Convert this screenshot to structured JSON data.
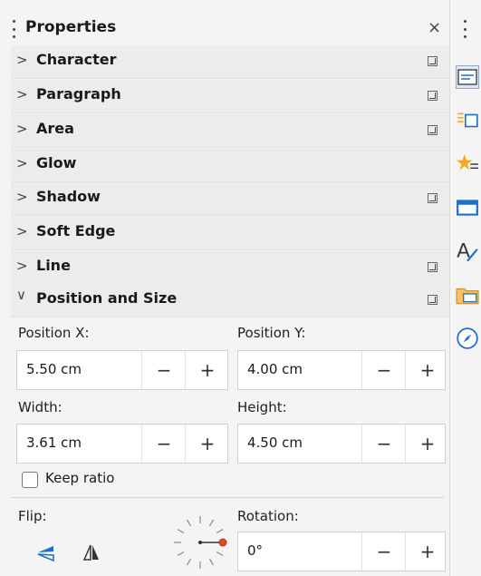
{
  "panel": {
    "title": "Properties",
    "close_icon": "close-icon"
  },
  "sections": [
    {
      "label": "Character",
      "expanded": false,
      "has_more": true
    },
    {
      "label": "Paragraph",
      "expanded": false,
      "has_more": true
    },
    {
      "label": "Area",
      "expanded": false,
      "has_more": true
    },
    {
      "label": "Glow",
      "expanded": false,
      "has_more": false
    },
    {
      "label": "Shadow",
      "expanded": false,
      "has_more": true
    },
    {
      "label": "Soft Edge",
      "expanded": false,
      "has_more": false
    },
    {
      "label": "Line",
      "expanded": false,
      "has_more": true
    },
    {
      "label": "Position and Size",
      "expanded": true,
      "has_more": true
    }
  ],
  "position_size": {
    "pos_x_label": "Position X:",
    "pos_x_value": "5.50 cm",
    "pos_y_label": "Position Y:",
    "pos_y_value": "4.00 cm",
    "width_label": "Width:",
    "width_value": "3.61 cm",
    "height_label": "Height:",
    "height_value": "4.50 cm",
    "keep_ratio_label": "Keep ratio",
    "keep_ratio_checked": false,
    "flip_label": "Flip:",
    "rotation_label": "Rotation:",
    "rotation_value": "0°",
    "minus": "−",
    "plus": "+"
  },
  "sidebar_icons": [
    "properties-icon",
    "styles-icon",
    "gallery-icon",
    "master-slides-icon",
    "font-icon",
    "navigator-icon",
    "compass-icon"
  ],
  "colors": {
    "accent": "#1e6fc9",
    "highlight": "#f5a623",
    "background": "#f4f4f4"
  }
}
